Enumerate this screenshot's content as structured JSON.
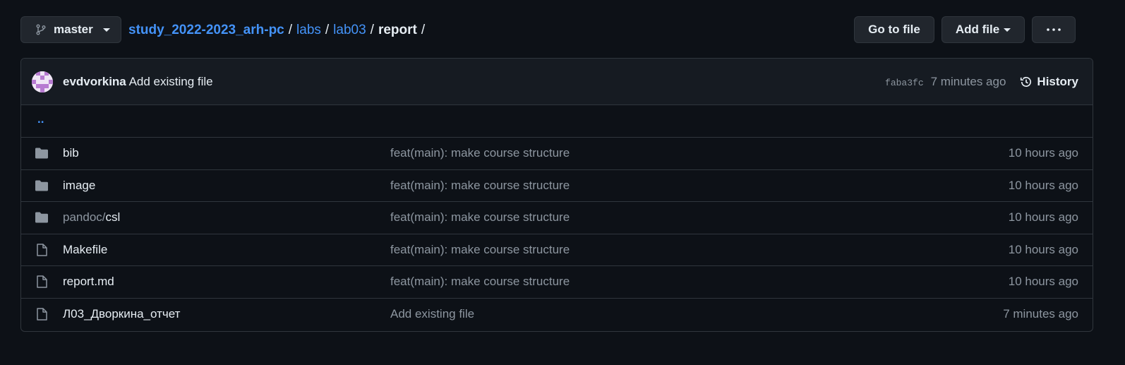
{
  "toolbar": {
    "branch": "master",
    "go_to_file": "Go to file",
    "add_file": "Add file",
    "more_icon": "kebab-horizontal-icon"
  },
  "breadcrumb": {
    "repo": "study_2022-2023_arh-pc",
    "sep1": "/",
    "labs": "labs",
    "sep2": "/",
    "lab": "lab03",
    "sep3": "/",
    "current": "report",
    "sep4": "/"
  },
  "commit": {
    "author": "evdvorkina",
    "message": "Add existing file",
    "sha": "faba3fc",
    "ago": "7 minutes ago",
    "history_label": "History"
  },
  "updir": "..",
  "files": [
    {
      "type": "folder",
      "name": "bib",
      "prefix": "",
      "message": "feat(main): make course structure",
      "age": "10 hours ago"
    },
    {
      "type": "folder",
      "name": "image",
      "prefix": "",
      "message": "feat(main): make course structure",
      "age": "10 hours ago"
    },
    {
      "type": "folder",
      "name": "csl",
      "prefix": "pandoc/",
      "message": "feat(main): make course structure",
      "age": "10 hours ago"
    },
    {
      "type": "file",
      "name": "Makefile",
      "prefix": "",
      "message": "feat(main): make course structure",
      "age": "10 hours ago"
    },
    {
      "type": "file",
      "name": "report.md",
      "prefix": "",
      "message": "feat(main): make course structure",
      "age": "10 hours ago"
    },
    {
      "type": "file",
      "name": "Л03_Дворкина_отчет",
      "prefix": "",
      "message": "Add existing file",
      "age": "7 minutes ago"
    }
  ],
  "colors": {
    "background": "#0d1117",
    "link": "#4493f8",
    "muted": "#8d96a0",
    "border": "#30363d"
  }
}
